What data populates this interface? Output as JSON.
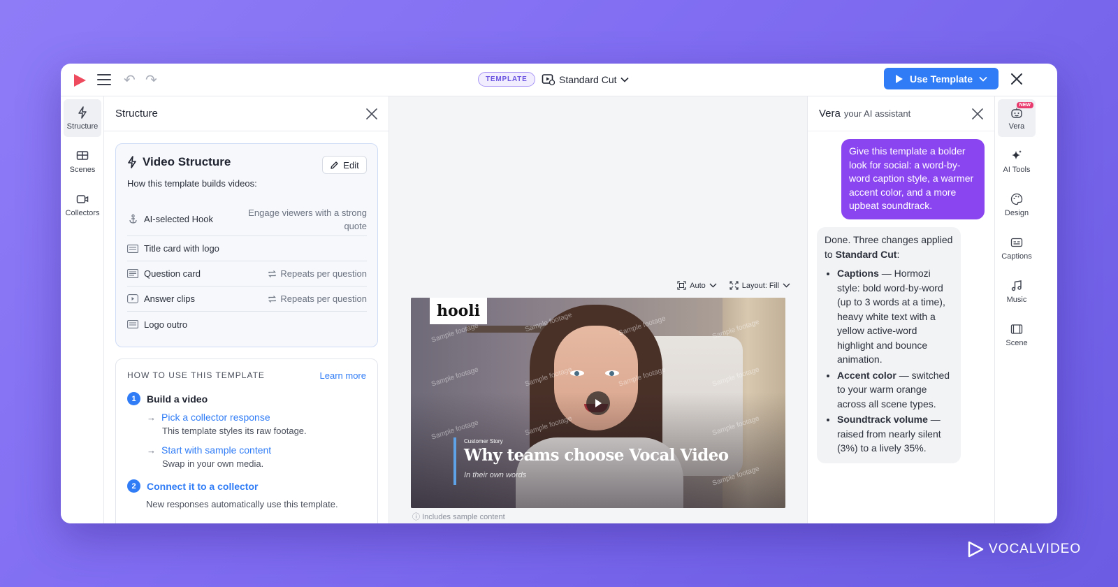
{
  "topbar": {
    "template_badge": "TEMPLATE",
    "cut_label": "Standard Cut",
    "use_template_label": "Use Template",
    "icons": [
      "logo-play-icon",
      "menu-icon",
      "undo-icon",
      "redo-icon",
      "video-icon",
      "chevron-down-icon",
      "play-icon",
      "close-icon"
    ]
  },
  "left_rail": {
    "items": [
      {
        "label": "Structure",
        "icon": "bolt-icon",
        "active": true
      },
      {
        "label": "Scenes",
        "icon": "scenes-icon"
      },
      {
        "label": "Collectors",
        "icon": "collector-icon"
      }
    ]
  },
  "structure_panel": {
    "title": "Structure",
    "video_structure": {
      "title": "Video Structure",
      "edit_label": "Edit",
      "description": "How this template builds videos:",
      "rows": [
        {
          "label": "AI-selected Hook",
          "note": "Engage viewers with a strong quote",
          "icon": "anchor-icon"
        },
        {
          "label": "Title card with logo",
          "note": "",
          "icon": "logo-card-icon"
        },
        {
          "label": "Question card",
          "note": "Repeats per question",
          "icon": "text-card-icon"
        },
        {
          "label": "Answer clips",
          "note": "Repeats per question",
          "icon": "clip-icon"
        },
        {
          "label": "Logo outro",
          "note": "",
          "icon": "logo-card-icon"
        }
      ]
    },
    "howto": {
      "heading": "HOW TO USE THIS TEMPLATE",
      "learn_more": "Learn more",
      "step1_num": "1",
      "step1_title": "Build a video",
      "sub1_link": "Pick a collector response",
      "sub1_desc": "This template styles its raw footage.",
      "sub2_link": "Start with sample content",
      "sub2_desc": "Swap in your own media.",
      "step2_num": "2",
      "step2_title": "Connect it to a collector",
      "step2_desc": "New responses automatically use this template."
    }
  },
  "canvas": {
    "aspect_label": "Auto",
    "layout_label": "Layout: Fill",
    "brand_logo_text": "hooli",
    "watermark": "Sample footage",
    "title_kicker": "Customer Story",
    "title_main": "Why teams choose Vocal Video",
    "title_sub": "In their own words",
    "below_note": "Includes sample content"
  },
  "vera": {
    "name": "Vera",
    "subtitle": "your AI assistant",
    "user_message": "Give this template a bolder look for social: a word-by-word caption style, a warmer accent color, and a more upbeat soundtrack.",
    "ai_intro": "Done. Three changes applied to",
    "ai_intro_bold": "Standard Cut",
    "ai_intro_end": ":",
    "ai_items": [
      {
        "bold": "Captions",
        "text": " — Hormozi style: bold word-by-word (up to 3 words at a time), heavy white text with a yellow active-word highlight and bounce animation."
      },
      {
        "bold": "Accent color",
        "text": " — switched to your warm orange across all scene types."
      },
      {
        "bold": "Soundtrack volume",
        "text": " — raised from nearly silent (3%) to a lively 35%."
      }
    ]
  },
  "right_rail": {
    "new_badge": "NEW",
    "items": [
      {
        "label": "Vera",
        "icon": "robot-icon",
        "active": true
      },
      {
        "label": "AI Tools",
        "icon": "sparkle-icon"
      },
      {
        "label": "Design",
        "icon": "palette-icon"
      },
      {
        "label": "Captions",
        "icon": "captions-icon"
      },
      {
        "label": "Music",
        "icon": "music-icon"
      },
      {
        "label": "Scene",
        "icon": "scene-icon"
      }
    ]
  },
  "brand": {
    "name": "VOCALVIDEO"
  },
  "colors": {
    "accent": "#2f7cf6",
    "user_bubble": "#8b45f0",
    "badge_border": "#a996f5",
    "background": "#7f6cf1"
  }
}
